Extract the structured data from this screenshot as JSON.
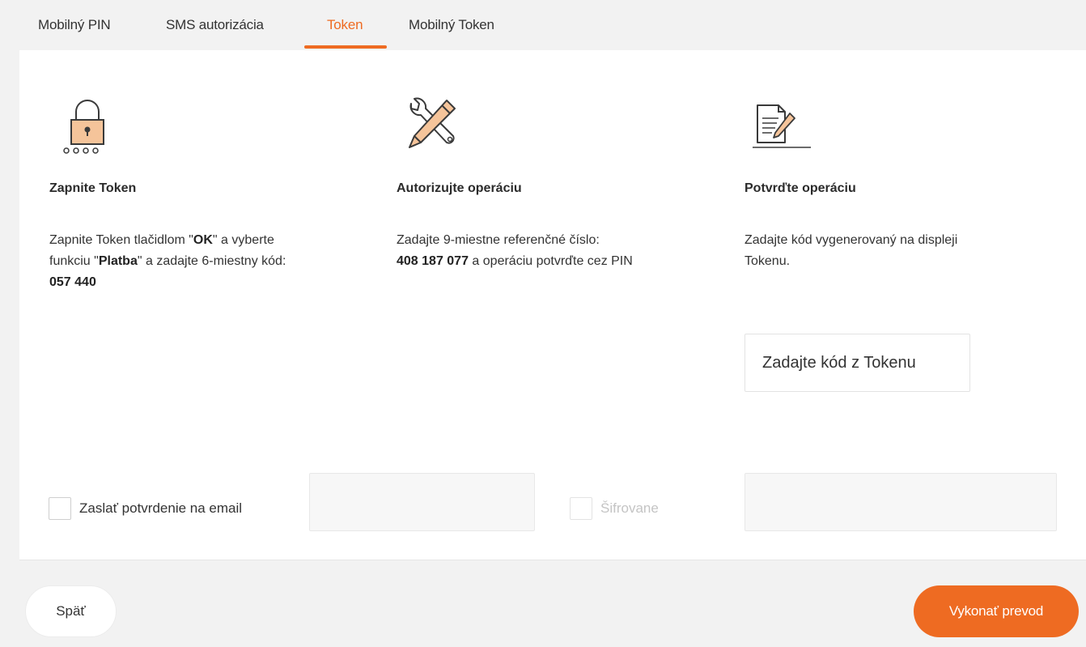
{
  "tabs": [
    {
      "label": "Mobilný PIN",
      "active": false
    },
    {
      "label": "SMS autorizácia",
      "active": false
    },
    {
      "label": "Token",
      "active": true
    },
    {
      "label": "Mobilný Token",
      "active": false
    }
  ],
  "steps": [
    {
      "icon": "padlock-icon",
      "title": "Zapnite Token",
      "desc_parts": [
        "Zapnite Token tlačidlom \"",
        "OK",
        "\" a vyberte funkciu \"",
        "Platba",
        "\" a zadajte 6-miestny kód: ",
        "057 440"
      ]
    },
    {
      "icon": "tools-icon",
      "title": "Autorizujte operáciu",
      "desc_parts": [
        "Zadajte 9-miestne referenčné číslo: ",
        "408 187 077",
        " a operáciu potvrďte cez PIN"
      ]
    },
    {
      "icon": "document-sign-icon",
      "title": "Potvrďte operáciu",
      "desc": "Zadajte kód vygenerovaný na displeji Tokenu."
    }
  ],
  "token_input": {
    "placeholder": "Zadajte kód z Tokenu",
    "value": ""
  },
  "email_confirm": {
    "label": "Zaslať potvrdenie na email",
    "checked": false,
    "email_value": ""
  },
  "encrypted": {
    "label": "Šifrovane",
    "checked": false,
    "disabled": true,
    "value": ""
  },
  "buttons": {
    "back_label": "Späť",
    "submit_label": "Vykonať prevod"
  },
  "colors": {
    "accent": "#ee6b22",
    "lock_fill": "#f5c49a",
    "icon_stroke": "#3a3a3a"
  }
}
